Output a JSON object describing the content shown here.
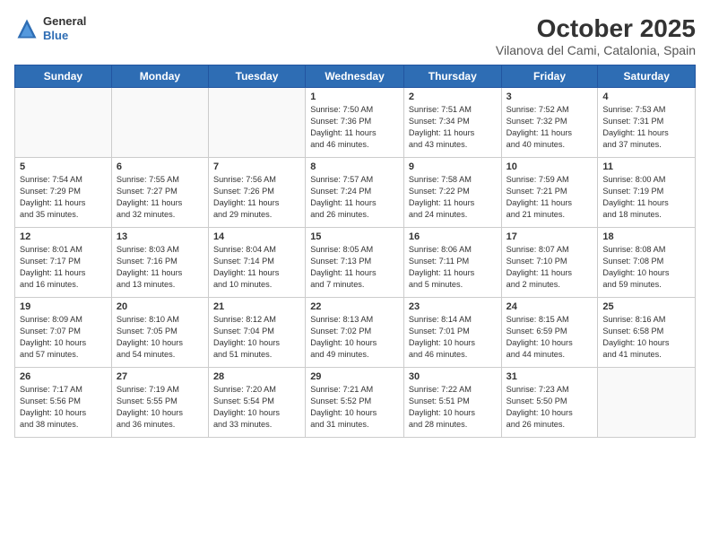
{
  "header": {
    "logo_general": "General",
    "logo_blue": "Blue",
    "month_title": "October 2025",
    "location": "Vilanova del Cami, Catalonia, Spain"
  },
  "weekdays": [
    "Sunday",
    "Monday",
    "Tuesday",
    "Wednesday",
    "Thursday",
    "Friday",
    "Saturday"
  ],
  "weeks": [
    [
      {
        "day": "",
        "info": ""
      },
      {
        "day": "",
        "info": ""
      },
      {
        "day": "",
        "info": ""
      },
      {
        "day": "1",
        "info": "Sunrise: 7:50 AM\nSunset: 7:36 PM\nDaylight: 11 hours\nand 46 minutes."
      },
      {
        "day": "2",
        "info": "Sunrise: 7:51 AM\nSunset: 7:34 PM\nDaylight: 11 hours\nand 43 minutes."
      },
      {
        "day": "3",
        "info": "Sunrise: 7:52 AM\nSunset: 7:32 PM\nDaylight: 11 hours\nand 40 minutes."
      },
      {
        "day": "4",
        "info": "Sunrise: 7:53 AM\nSunset: 7:31 PM\nDaylight: 11 hours\nand 37 minutes."
      }
    ],
    [
      {
        "day": "5",
        "info": "Sunrise: 7:54 AM\nSunset: 7:29 PM\nDaylight: 11 hours\nand 35 minutes."
      },
      {
        "day": "6",
        "info": "Sunrise: 7:55 AM\nSunset: 7:27 PM\nDaylight: 11 hours\nand 32 minutes."
      },
      {
        "day": "7",
        "info": "Sunrise: 7:56 AM\nSunset: 7:26 PM\nDaylight: 11 hours\nand 29 minutes."
      },
      {
        "day": "8",
        "info": "Sunrise: 7:57 AM\nSunset: 7:24 PM\nDaylight: 11 hours\nand 26 minutes."
      },
      {
        "day": "9",
        "info": "Sunrise: 7:58 AM\nSunset: 7:22 PM\nDaylight: 11 hours\nand 24 minutes."
      },
      {
        "day": "10",
        "info": "Sunrise: 7:59 AM\nSunset: 7:21 PM\nDaylight: 11 hours\nand 21 minutes."
      },
      {
        "day": "11",
        "info": "Sunrise: 8:00 AM\nSunset: 7:19 PM\nDaylight: 11 hours\nand 18 minutes."
      }
    ],
    [
      {
        "day": "12",
        "info": "Sunrise: 8:01 AM\nSunset: 7:17 PM\nDaylight: 11 hours\nand 16 minutes."
      },
      {
        "day": "13",
        "info": "Sunrise: 8:03 AM\nSunset: 7:16 PM\nDaylight: 11 hours\nand 13 minutes."
      },
      {
        "day": "14",
        "info": "Sunrise: 8:04 AM\nSunset: 7:14 PM\nDaylight: 11 hours\nand 10 minutes."
      },
      {
        "day": "15",
        "info": "Sunrise: 8:05 AM\nSunset: 7:13 PM\nDaylight: 11 hours\nand 7 minutes."
      },
      {
        "day": "16",
        "info": "Sunrise: 8:06 AM\nSunset: 7:11 PM\nDaylight: 11 hours\nand 5 minutes."
      },
      {
        "day": "17",
        "info": "Sunrise: 8:07 AM\nSunset: 7:10 PM\nDaylight: 11 hours\nand 2 minutes."
      },
      {
        "day": "18",
        "info": "Sunrise: 8:08 AM\nSunset: 7:08 PM\nDaylight: 10 hours\nand 59 minutes."
      }
    ],
    [
      {
        "day": "19",
        "info": "Sunrise: 8:09 AM\nSunset: 7:07 PM\nDaylight: 10 hours\nand 57 minutes."
      },
      {
        "day": "20",
        "info": "Sunrise: 8:10 AM\nSunset: 7:05 PM\nDaylight: 10 hours\nand 54 minutes."
      },
      {
        "day": "21",
        "info": "Sunrise: 8:12 AM\nSunset: 7:04 PM\nDaylight: 10 hours\nand 51 minutes."
      },
      {
        "day": "22",
        "info": "Sunrise: 8:13 AM\nSunset: 7:02 PM\nDaylight: 10 hours\nand 49 minutes."
      },
      {
        "day": "23",
        "info": "Sunrise: 8:14 AM\nSunset: 7:01 PM\nDaylight: 10 hours\nand 46 minutes."
      },
      {
        "day": "24",
        "info": "Sunrise: 8:15 AM\nSunset: 6:59 PM\nDaylight: 10 hours\nand 44 minutes."
      },
      {
        "day": "25",
        "info": "Sunrise: 8:16 AM\nSunset: 6:58 PM\nDaylight: 10 hours\nand 41 minutes."
      }
    ],
    [
      {
        "day": "26",
        "info": "Sunrise: 7:17 AM\nSunset: 5:56 PM\nDaylight: 10 hours\nand 38 minutes."
      },
      {
        "day": "27",
        "info": "Sunrise: 7:19 AM\nSunset: 5:55 PM\nDaylight: 10 hours\nand 36 minutes."
      },
      {
        "day": "28",
        "info": "Sunrise: 7:20 AM\nSunset: 5:54 PM\nDaylight: 10 hours\nand 33 minutes."
      },
      {
        "day": "29",
        "info": "Sunrise: 7:21 AM\nSunset: 5:52 PM\nDaylight: 10 hours\nand 31 minutes."
      },
      {
        "day": "30",
        "info": "Sunrise: 7:22 AM\nSunset: 5:51 PM\nDaylight: 10 hours\nand 28 minutes."
      },
      {
        "day": "31",
        "info": "Sunrise: 7:23 AM\nSunset: 5:50 PM\nDaylight: 10 hours\nand 26 minutes."
      },
      {
        "day": "",
        "info": ""
      }
    ]
  ]
}
